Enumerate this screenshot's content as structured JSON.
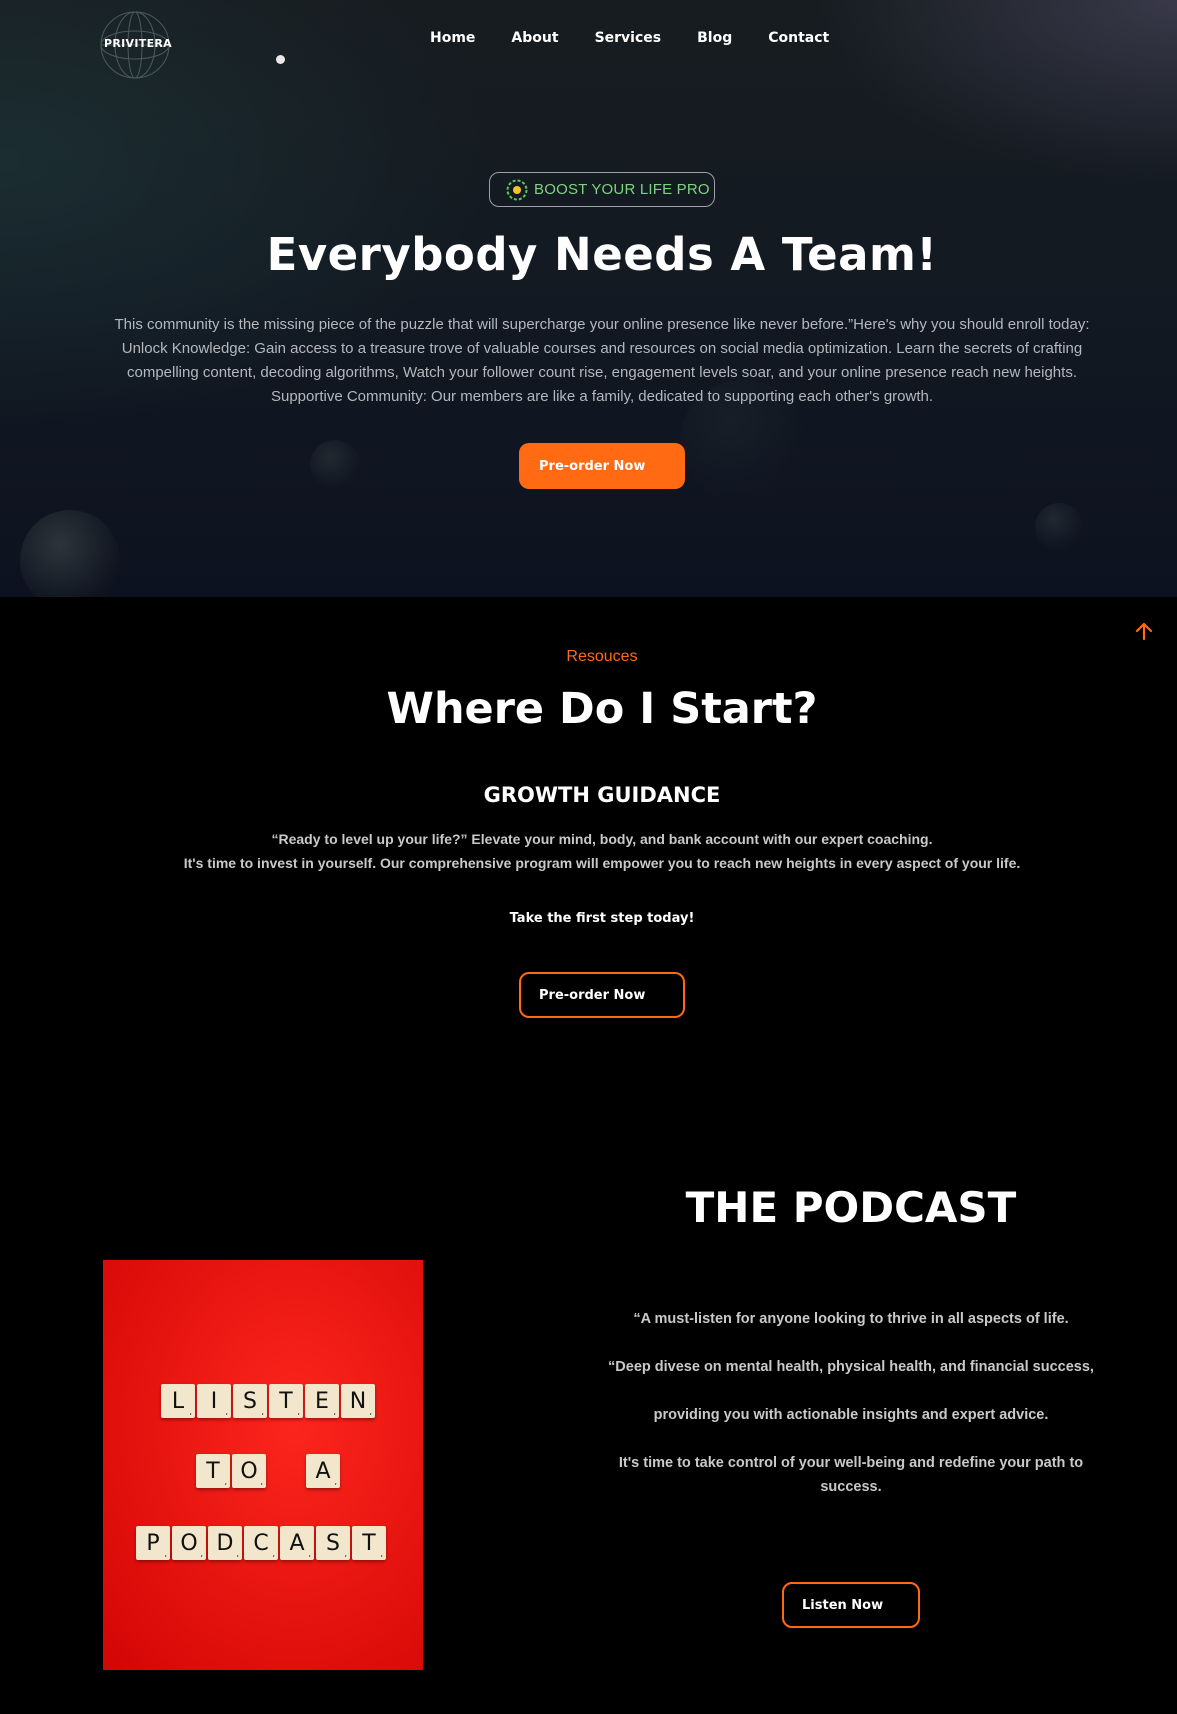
{
  "header": {
    "logo_text": "PRIVITERA",
    "nav": [
      "Home",
      "About",
      "Services",
      "Blog",
      "Contact"
    ]
  },
  "hero": {
    "badge": "BOOST YOUR LIFE PRO",
    "title": "Everybody Needs A Team!",
    "description_lines": [
      "This community is the missing piece of the puzzle that will supercharge your online presence like never before.”Here's why you should enroll today:",
      "Unlock Knowledge: Gain access to a treasure trove of valuable courses and resources on social media optimization. Learn the secrets of crafting",
      "compelling content, decoding algorithms, Watch your follower count rise, engagement levels soar, and your online presence reach new heights.",
      "Supportive Community: Our members are like a family, dedicated to supporting each other's growth."
    ],
    "cta": "Pre-order Now"
  },
  "resources": {
    "eyebrow": "Resouces",
    "title": "Where Do I Start?",
    "subtitle": "GROWTH GUIDANCE",
    "lines": [
      "“Ready to level up your life?” Elevate your mind, body, and bank account with our expert coaching.",
      "It's time to invest in yourself. Our comprehensive program will empower you to reach new heights in every aspect of your life."
    ],
    "first_step": "Take the first step today!",
    "cta": "Pre-order Now"
  },
  "podcast": {
    "title": "THE PODCAST",
    "image_words": [
      "LISTEN",
      "TO",
      "A",
      "PODCAST"
    ],
    "lines": [
      "“A must-listen for anyone looking to thrive in all aspects of life.",
      "“Deep divese on mental health, physical health, and financial success,",
      "providing you with actionable insights and expert advice.",
      "It's time to take control of your well-being and redefine your path to success."
    ],
    "cta": "Listen Now"
  },
  "colors": {
    "accent": "#ff6a13",
    "badge_text": "#7fd37f",
    "podcast_bg": "#e30d0d"
  }
}
